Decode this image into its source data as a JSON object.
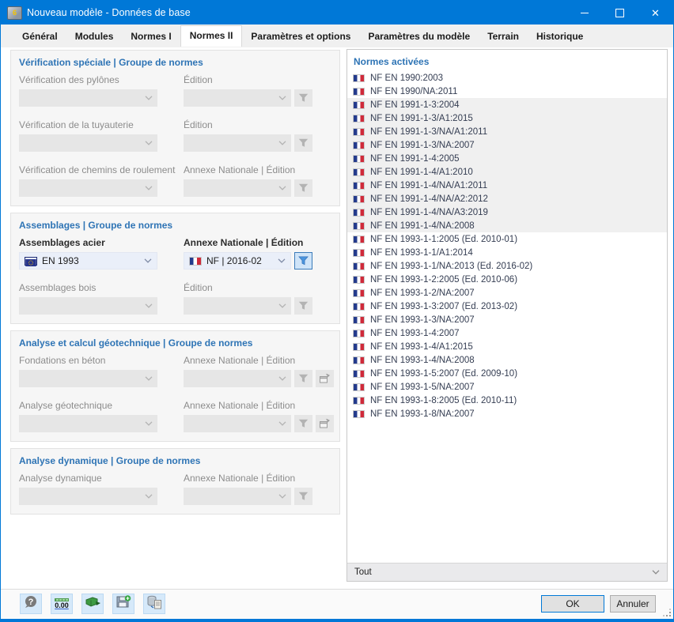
{
  "window": {
    "title": "Nouveau modèle - Données de base",
    "controls": [
      "minimize-icon",
      "maximize-icon",
      "close-icon"
    ],
    "accent_color": "#0078d7"
  },
  "tabs": {
    "active": "Normes II",
    "items": [
      {
        "label": "Général"
      },
      {
        "label": "Modules"
      },
      {
        "label": "Normes I"
      },
      {
        "label": "Normes II"
      },
      {
        "label": "Paramètres et options"
      },
      {
        "label": "Paramètres du modèle"
      },
      {
        "label": "Terrain"
      },
      {
        "label": "Historique"
      }
    ]
  },
  "left": {
    "groups": [
      {
        "title": "Vérification spéciale | Groupe de normes",
        "rows": [
          {
            "field1": {
              "label": "Vérification des pylônes",
              "value": "",
              "enabled": false
            },
            "field2": {
              "label": "Édition",
              "value": "",
              "enabled": false
            },
            "buttons": [
              {
                "type": "filter",
                "enabled": false
              }
            ]
          },
          {
            "field1": {
              "label": "Vérification de la tuyauterie",
              "value": "",
              "enabled": false
            },
            "field2": {
              "label": "Édition",
              "value": "",
              "enabled": false
            },
            "buttons": [
              {
                "type": "filter",
                "enabled": false
              }
            ]
          },
          {
            "field1": {
              "label": "Vérification de chemins de roulement",
              "value": "",
              "enabled": false
            },
            "field2": {
              "label": "Annexe Nationale | Édition",
              "value": "",
              "enabled": false
            },
            "buttons": [
              {
                "type": "filter",
                "enabled": false
              }
            ]
          }
        ]
      },
      {
        "title": "Assemblages | Groupe de normes",
        "rows": [
          {
            "field1": {
              "label": "Assemblages acier",
              "value": "EN 1993",
              "flag": "eu",
              "enabled": true
            },
            "field2": {
              "label": "Annexe Nationale | Édition",
              "value": "NF | 2016-02",
              "flag": "fr",
              "enabled": true
            },
            "buttons": [
              {
                "type": "filter",
                "enabled": true,
                "active": true
              }
            ]
          },
          {
            "field1": {
              "label": "Assemblages bois",
              "value": "",
              "enabled": false
            },
            "field2": {
              "label": "Édition",
              "value": "",
              "enabled": false
            },
            "buttons": [
              {
                "type": "filter",
                "enabled": false
              }
            ]
          }
        ]
      },
      {
        "title": "Analyse et calcul géotechnique | Groupe de normes",
        "rows": [
          {
            "field1": {
              "label": "Fondations en béton",
              "value": "",
              "enabled": false
            },
            "field2": {
              "label": "Annexe Nationale | Édition",
              "value": "",
              "enabled": false
            },
            "buttons": [
              {
                "type": "filter",
                "enabled": false
              },
              {
                "type": "annex",
                "enabled": false
              }
            ]
          },
          {
            "field1": {
              "label": "Analyse géotechnique",
              "value": "",
              "enabled": false
            },
            "field2": {
              "label": "Annexe Nationale | Édition",
              "value": "",
              "enabled": false
            },
            "buttons": [
              {
                "type": "filter",
                "enabled": false
              },
              {
                "type": "annex",
                "enabled": false
              }
            ]
          }
        ]
      },
      {
        "title": "Analyse dynamique | Groupe de normes",
        "rows": [
          {
            "field1": {
              "label": "Analyse dynamique",
              "value": "",
              "enabled": false
            },
            "field2": {
              "label": "Annexe Nationale | Édition",
              "value": "",
              "enabled": false
            },
            "buttons": [
              {
                "type": "filter",
                "enabled": false
              }
            ]
          }
        ]
      }
    ]
  },
  "right": {
    "title": "Normes activées",
    "filter_value": "Tout",
    "items": [
      {
        "text": "NF EN 1990:2003",
        "flag": "fr",
        "highlighted": false
      },
      {
        "text": "NF EN 1990/NA:2011",
        "flag": "fr",
        "highlighted": false
      },
      {
        "text": "NF EN 1991-1-3:2004",
        "flag": "fr",
        "highlighted": true
      },
      {
        "text": "NF EN 1991-1-3/A1:2015",
        "flag": "fr",
        "highlighted": true
      },
      {
        "text": "NF EN 1991-1-3/NA/A1:2011",
        "flag": "fr",
        "highlighted": true
      },
      {
        "text": "NF EN 1991-1-3/NA:2007",
        "flag": "fr",
        "highlighted": true
      },
      {
        "text": "NF EN 1991-1-4:2005",
        "flag": "fr",
        "highlighted": true
      },
      {
        "text": "NF EN 1991-1-4/A1:2010",
        "flag": "fr",
        "highlighted": true
      },
      {
        "text": "NF EN 1991-1-4/NA/A1:2011",
        "flag": "fr",
        "highlighted": true
      },
      {
        "text": "NF EN 1991-1-4/NA/A2:2012",
        "flag": "fr",
        "highlighted": true
      },
      {
        "text": "NF EN 1991-1-4/NA/A3:2019",
        "flag": "fr",
        "highlighted": true
      },
      {
        "text": "NF EN 1991-1-4/NA:2008",
        "flag": "fr",
        "highlighted": true
      },
      {
        "text": "NF EN 1993-1-1:2005 (Ed. 2010-01)",
        "flag": "fr",
        "highlighted": false
      },
      {
        "text": "NF EN 1993-1-1/A1:2014",
        "flag": "fr",
        "highlighted": false
      },
      {
        "text": "NF EN 1993-1-1/NA:2013 (Ed. 2016-02)",
        "flag": "fr",
        "highlighted": false
      },
      {
        "text": "NF EN 1993-1-2:2005 (Ed. 2010-06)",
        "flag": "fr",
        "highlighted": false
      },
      {
        "text": "NF EN 1993-1-2/NA:2007",
        "flag": "fr",
        "highlighted": false
      },
      {
        "text": "NF EN 1993-1-3:2007 (Ed. 2013-02)",
        "flag": "fr",
        "highlighted": false
      },
      {
        "text": "NF EN 1993-1-3/NA:2007",
        "flag": "fr",
        "highlighted": false
      },
      {
        "text": "NF EN 1993-1-4:2007",
        "flag": "fr",
        "highlighted": false
      },
      {
        "text": "NF EN 1993-1-4/A1:2015",
        "flag": "fr",
        "highlighted": false
      },
      {
        "text": "NF EN 1993-1-4/NA:2008",
        "flag": "fr",
        "highlighted": false
      },
      {
        "text": "NF EN 1993-1-5:2007 (Ed. 2009-10)",
        "flag": "fr",
        "highlighted": false
      },
      {
        "text": "NF EN 1993-1-5/NA:2007",
        "flag": "fr",
        "highlighted": false
      },
      {
        "text": "NF EN 1993-1-8:2005 (Ed. 2010-11)",
        "flag": "fr",
        "highlighted": false
      },
      {
        "text": "NF EN 1993-1-8/NA:2007",
        "flag": "fr",
        "highlighted": false
      }
    ]
  },
  "toolbar": {
    "units_text": "0.00",
    "buttons": [
      {
        "name": "help",
        "icon": "help-icon"
      },
      {
        "name": "units",
        "icon": "units-icon"
      },
      {
        "name": "options",
        "icon": "import-icon"
      },
      {
        "name": "save-defaults",
        "icon": "save-icon"
      },
      {
        "name": "database",
        "icon": "database-copy-icon"
      }
    ]
  },
  "footer": {
    "ok_label": "OK",
    "cancel_label": "Annuler"
  }
}
